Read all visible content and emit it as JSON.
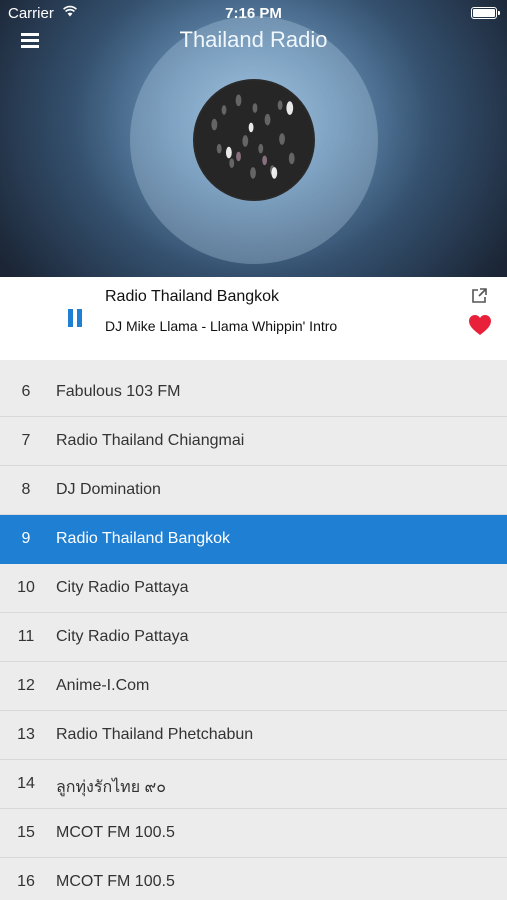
{
  "status_bar": {
    "carrier": "Carrier",
    "time": "7:16 PM"
  },
  "header": {
    "title": "Thailand Radio",
    "menu_icon": "hamburger-menu-icon"
  },
  "now_playing": {
    "station": "Radio Thailand Bangkok",
    "track": "DJ Mike Llama - Llama Whippin' Intro",
    "state": "playing",
    "favorite": true
  },
  "colors": {
    "accent": "#1f7fd3",
    "heart": "#e8203a",
    "list_bg": "#ececec"
  },
  "stations": [
    {
      "num": "6",
      "name": "Fabulous 103 FM",
      "active": false
    },
    {
      "num": "7",
      "name": "Radio Thailand Chiangmai",
      "active": false
    },
    {
      "num": "8",
      "name": "DJ Domination",
      "active": false
    },
    {
      "num": "9",
      "name": "Radio Thailand Bangkok",
      "active": true
    },
    {
      "num": "10",
      "name": "City Radio Pattaya",
      "active": false
    },
    {
      "num": "11",
      "name": "City Radio Pattaya",
      "active": false
    },
    {
      "num": "12",
      "name": "Anime-I.Com",
      "active": false
    },
    {
      "num": "13",
      "name": "Radio Thailand Phetchabun",
      "active": false
    },
    {
      "num": "14",
      "name": "ลูกทุ่งรักไทย ๙๐",
      "active": false
    },
    {
      "num": "15",
      "name": "MCOT FM 100.5",
      "active": false
    },
    {
      "num": "16",
      "name": "MCOT FM 100.5",
      "active": false
    }
  ]
}
